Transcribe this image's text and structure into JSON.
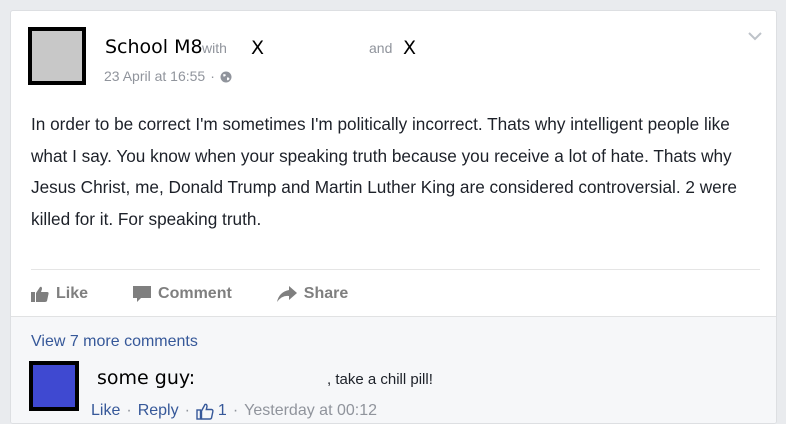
{
  "post": {
    "author": "School M8",
    "with_label": "with",
    "tagged_first": "X",
    "and_label": "and",
    "tagged_second": "X",
    "timestamp": "23 April at 16:55",
    "meta_separator": "·",
    "privacy_icon": "globe-icon",
    "body": "In order to be correct I'm sometimes I'm politically incorrect. Thats why intelligent people like what I say. You know when your speaking truth because you receive a lot of hate. Thats why Jesus Christ, me, Donald Trump and Martin Luther King are considered controversial. 2 were killed for it. For speaking truth."
  },
  "actions": {
    "like": "Like",
    "comment": "Comment",
    "share": "Share"
  },
  "comments": {
    "view_more": "View 7 more comments",
    "items": [
      {
        "author": "some guy:",
        "text": ", take a chill pill!",
        "like": "Like",
        "reply": "Reply",
        "like_count": "1",
        "time": "Yesterday at 00:12",
        "separator": "·"
      }
    ]
  },
  "colors": {
    "background": "#e9ebee",
    "link": "#365899",
    "meta": "#90949c",
    "text": "#1d2129",
    "comment_avatar": "#3f49d1",
    "post_avatar": "#c8c8c8"
  }
}
